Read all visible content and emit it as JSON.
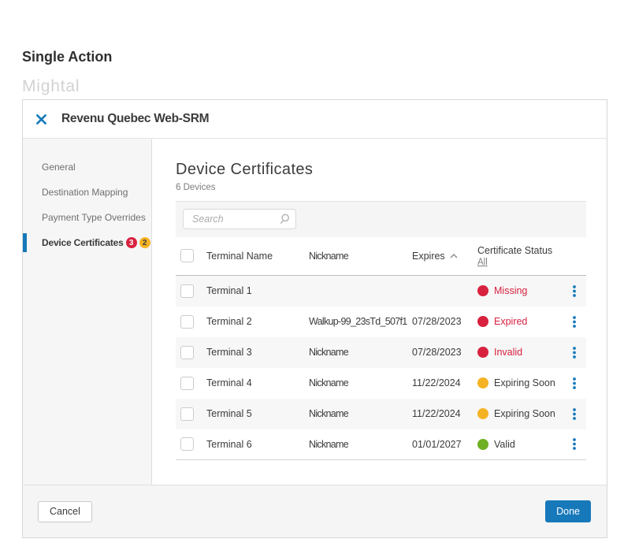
{
  "page": {
    "pretitle": "Single Action",
    "watermark": "Mightal"
  },
  "colors": {
    "accent_blue": "#1779ba",
    "status_red": "#d8213f",
    "status_yellow": "#f5b324",
    "status_green": "#6fb022"
  },
  "modal": {
    "title": "Revenu Quebec Web-SRM",
    "close_icon": "x-icon",
    "sidebar": {
      "items": [
        {
          "label": "General"
        },
        {
          "label": "Destination Mapping"
        },
        {
          "label": "Payment Type Overrides"
        },
        {
          "label": "Device Certificates"
        }
      ],
      "active_item": "Device Certificates",
      "active_badges": [
        {
          "count": "3",
          "color": "red"
        },
        {
          "count": "2",
          "color": "yellow"
        }
      ]
    },
    "content": {
      "heading": "Device Certificates",
      "subheading": "6 Devices",
      "search": {
        "placeholder": "Search",
        "value": "",
        "icon": "search-icon"
      },
      "table": {
        "columns": {
          "terminal": "Terminal Name",
          "nickname": "Nickname",
          "expires": "Expires",
          "status": "Certificate Status"
        },
        "expires_sort": "ascending",
        "status_filter": "All",
        "rows": [
          {
            "terminal": "Terminal 1",
            "nickname": "",
            "expires": "",
            "status": "Missing",
            "status_color": "red"
          },
          {
            "terminal": "Terminal 2",
            "nickname": "Walkup-99_23sTd_507f1",
            "expires": "07/28/2023",
            "status": "Expired",
            "status_color": "red"
          },
          {
            "terminal": "Terminal 3",
            "nickname": "Nickname",
            "expires": "07/28/2023",
            "status": "Invalid",
            "status_color": "red"
          },
          {
            "terminal": "Terminal 4",
            "nickname": "Nickname",
            "expires": "11/22/2024",
            "status": "Expiring Soon",
            "status_color": "yellow"
          },
          {
            "terminal": "Terminal 5",
            "nickname": "Nickname",
            "expires": "11/22/2024",
            "status": "Expiring Soon",
            "status_color": "yellow"
          },
          {
            "terminal": "Terminal 6",
            "nickname": "Nickname",
            "expires": "01/01/2027",
            "status": "Valid",
            "status_color": "green"
          }
        ]
      }
    },
    "footer": {
      "cancel_label": "Cancel",
      "done_label": "Done"
    }
  }
}
